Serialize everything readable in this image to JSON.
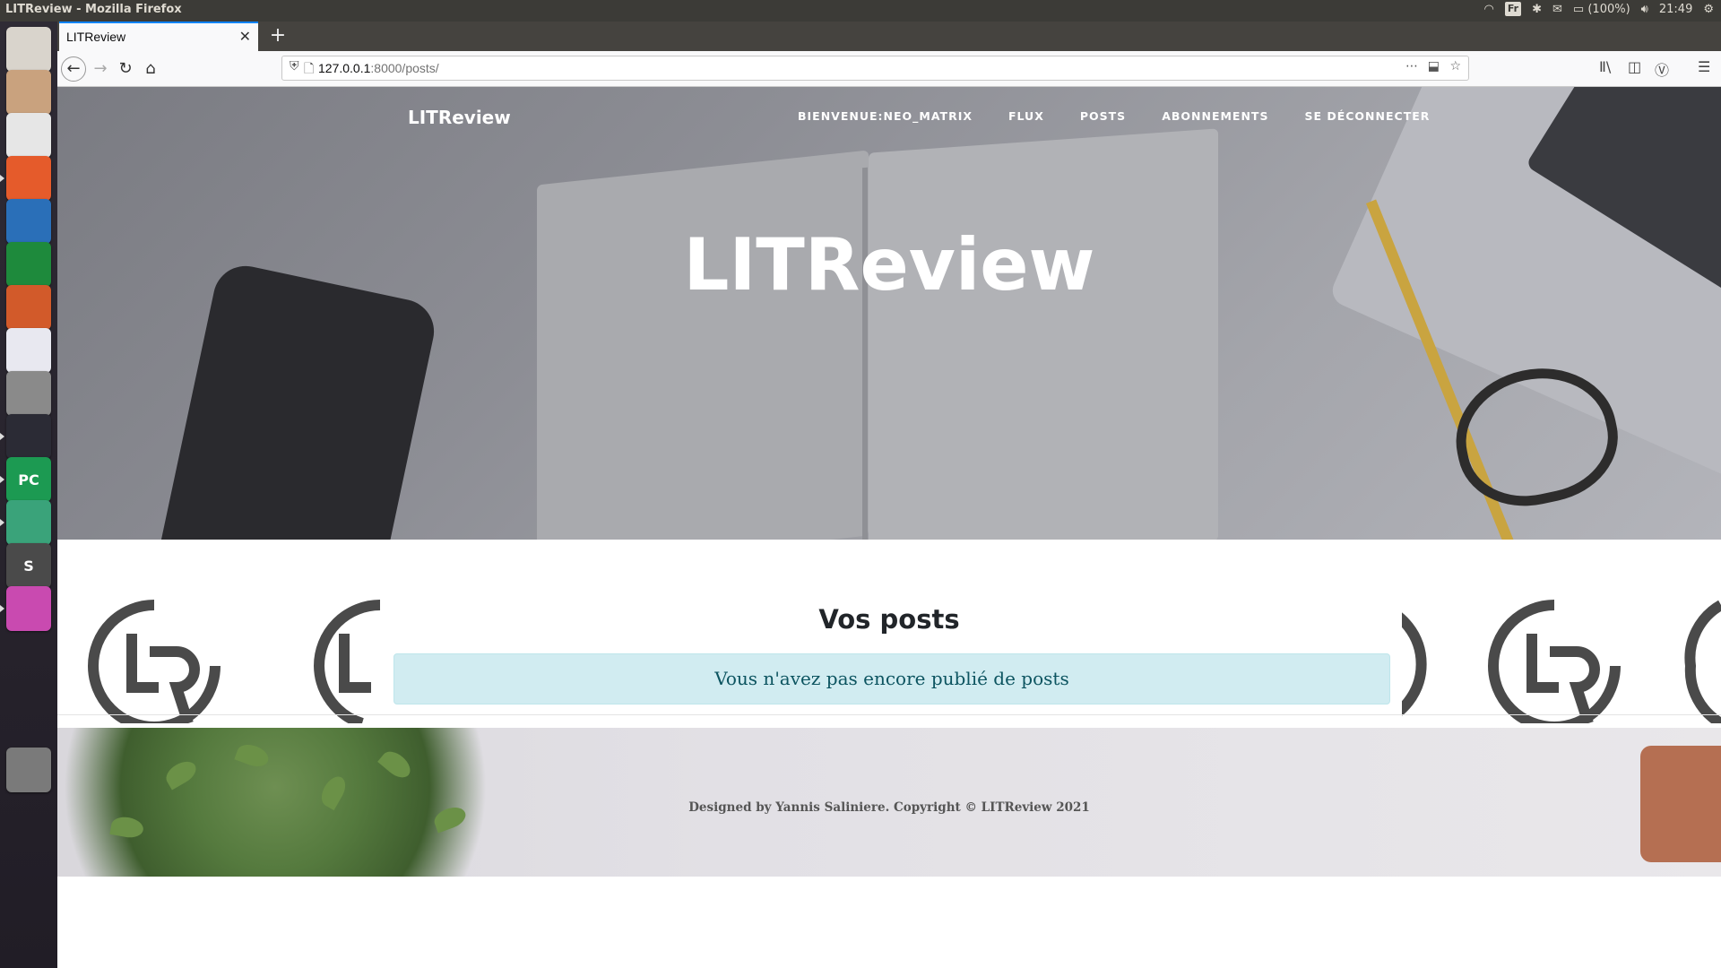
{
  "os_panel": {
    "window_title": "LITReview - Mozilla Firefox",
    "keyboard_layout": "Fr",
    "battery": "(100%)",
    "clock": "21:49"
  },
  "launcher": {
    "apps": [
      {
        "name": "ubuntu-dash",
        "color": "#d9d4cc"
      },
      {
        "name": "files",
        "color": "#c9a27e"
      },
      {
        "name": "chrome",
        "color": "#e6e6e6"
      },
      {
        "name": "firefox",
        "color": "#e55b2b"
      },
      {
        "name": "libreoffice-writer",
        "color": "#2a6fb8"
      },
      {
        "name": "libreoffice-calc",
        "color": "#1e8a3c"
      },
      {
        "name": "libreoffice-impress",
        "color": "#d25a2a"
      },
      {
        "name": "software-center",
        "color": "#e8e8f0"
      },
      {
        "name": "system-settings",
        "color": "#8a8a8a"
      },
      {
        "name": "terminal",
        "color": "#2b2b35"
      },
      {
        "name": "pycharm",
        "color": "#1c9a52",
        "label": "PC"
      },
      {
        "name": "atom",
        "color": "#3aa37a"
      },
      {
        "name": "sublime-text",
        "color": "#4a4a4a",
        "label": "S"
      },
      {
        "name": "screen-app",
        "color": "#c94ab0"
      },
      {
        "name": "trash",
        "color": "#7a7a7a"
      }
    ]
  },
  "browser": {
    "tab_title": "LITReview",
    "url_host": "127.0.0.1",
    "url_rest": ":8000/posts/"
  },
  "site": {
    "brand": "LITReview",
    "nav": [
      "BIENVENUE:NEO_MATRIX",
      "FLUX",
      "POSTS",
      "ABONNEMENTS",
      "SE DÉCONNECTER"
    ],
    "hero_title": "LITReview",
    "posts_title": "Vos posts",
    "empty_message": "Vous n'avez pas encore publié de posts",
    "footer": "Designed by Yannis Saliniere. Copyright © LITReview 2021"
  },
  "colors": {
    "alert_bg": "#d1ecf1",
    "alert_text": "#0c5460",
    "tab_accent": "#0a84ff"
  }
}
